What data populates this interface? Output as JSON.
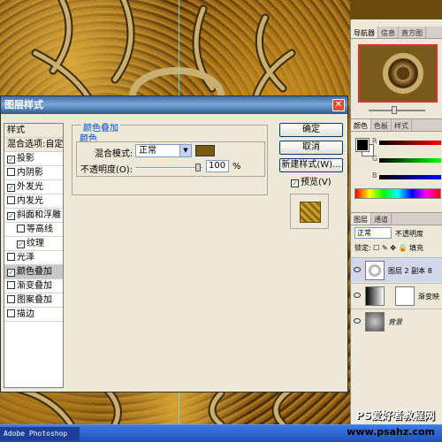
{
  "dialog": {
    "title": "图层样式",
    "close_glyph": "✕",
    "styles_header": "样式",
    "styles": [
      {
        "label": "混合选项:自定",
        "checked": null
      },
      {
        "label": "投影",
        "checked": true
      },
      {
        "label": "内阴影",
        "checked": false
      },
      {
        "label": "外发光",
        "checked": true
      },
      {
        "label": "内发光",
        "checked": false
      },
      {
        "label": "斜面和浮雕",
        "checked": true
      },
      {
        "label": "等高线",
        "checked": false
      },
      {
        "label": "纹理",
        "checked": true
      },
      {
        "label": "光泽",
        "checked": false
      },
      {
        "label": "颜色叠加",
        "checked": true
      },
      {
        "label": "渐变叠加",
        "checked": false
      },
      {
        "label": "图案叠加",
        "checked": false
      },
      {
        "label": "描边",
        "checked": false
      }
    ],
    "overlay": {
      "group_title": "颜色叠加",
      "sub_title": "颜色",
      "blend_label": "混合模式:",
      "blend_value": "正常",
      "opacity_label": "不透明度(O):",
      "opacity_value": "100",
      "opacity_unit": "%",
      "swatch_color": "#7a5a10"
    },
    "buttons": {
      "ok": "确定",
      "cancel": "取消",
      "new_style": "新建样式(W)...",
      "preview": "预览(V)"
    }
  },
  "panels": {
    "navigator_tabs": [
      "导航器",
      "信息",
      "直方图"
    ],
    "color_tabs": [
      "颜色",
      "色板",
      "样式"
    ],
    "color_channels": [
      "R",
      "G",
      "B"
    ],
    "layers_tabs": [
      "图层",
      "通道"
    ],
    "blend_mode": "正常",
    "opacity_label": "不透明度",
    "lock_label": "锁定:",
    "fill_label": "填充",
    "layers": [
      {
        "name": "图层 2 副本 8"
      },
      {
        "name": "渐变映"
      },
      {
        "name": "背景"
      }
    ]
  },
  "taskbar": {
    "task": "Adobe Photoshop"
  },
  "watermark": {
    "line1": "PS爱好者教程网",
    "line2": "www.psahz.com"
  }
}
